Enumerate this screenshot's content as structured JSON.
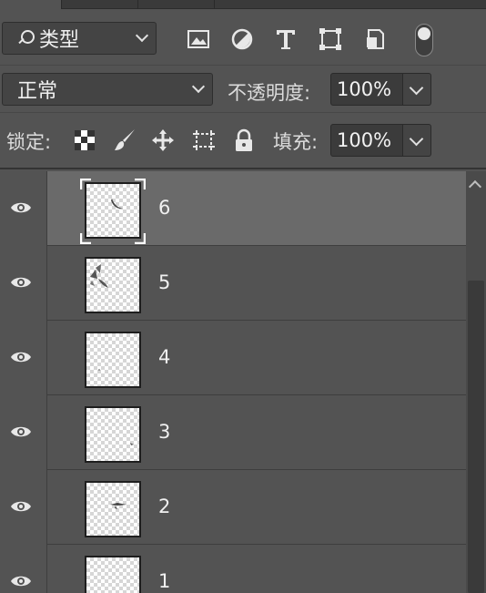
{
  "filter": {
    "kind_label": "类型",
    "icons": [
      "image-filter-icon",
      "adjustment-filter-icon",
      "type-filter-icon",
      "shape-filter-icon",
      "smart-object-filter-icon"
    ]
  },
  "blend": {
    "mode": "正常",
    "opacity_label": "不透明度:",
    "opacity_value": "100%"
  },
  "lock": {
    "label": "锁定:",
    "icons": [
      "lock-transparent-pixels-icon",
      "lock-image-pixels-icon",
      "lock-position-icon",
      "lock-artboard-icon",
      "lock-all-icon"
    ],
    "fill_label": "填充:",
    "fill_value": "100%"
  },
  "layers": [
    {
      "name": "6",
      "selected": true
    },
    {
      "name": "5",
      "selected": false
    },
    {
      "name": "4",
      "selected": false
    },
    {
      "name": "3",
      "selected": false
    },
    {
      "name": "2",
      "selected": false
    },
    {
      "name": "1",
      "selected": false
    }
  ]
}
